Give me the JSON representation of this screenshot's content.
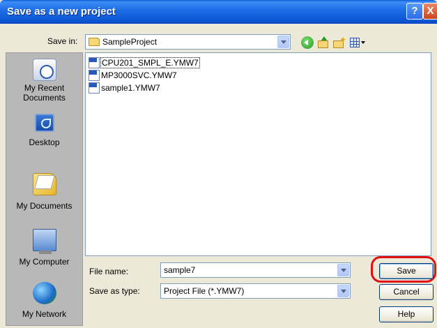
{
  "window": {
    "title": "Save as a new project",
    "help_label": "?",
    "close_label": "X"
  },
  "toolbar": {
    "save_in_label": "Save in:",
    "save_in_value": "SampleProject",
    "icons": [
      "back-icon",
      "up-folder-icon",
      "new-folder-icon",
      "views-menu-icon"
    ]
  },
  "places": [
    {
      "label_line1": "My Recent",
      "label_line2": "Documents",
      "icon": "recent-documents-icon"
    },
    {
      "label_line1": "Desktop",
      "label_line2": "",
      "icon": "desktop-icon"
    },
    {
      "label_line1": "My Documents",
      "label_line2": "",
      "icon": "my-documents-icon"
    },
    {
      "label_line1": "My Computer",
      "label_line2": "",
      "icon": "my-computer-icon"
    },
    {
      "label_line1": "My Network",
      "label_line2": "",
      "icon": "my-network-icon"
    }
  ],
  "files": [
    {
      "name": "CPU201_SMPL_E.YMW7",
      "icon": "mpe-file-icon"
    },
    {
      "name": "MP3000SVC.YMW7",
      "icon": "mpe-file-icon"
    },
    {
      "name": "sample1.YMW7",
      "icon": "mpe-file-icon"
    }
  ],
  "form": {
    "file_name_label": "File name:",
    "file_name_value": "sample7",
    "save_as_type_label": "Save as type:",
    "save_as_type_value": "Project File (*.YMW7)"
  },
  "buttons": {
    "save": "Save",
    "cancel": "Cancel",
    "help": "Help"
  },
  "colors": {
    "titlebar": "#0b54d2",
    "dialog_bg": "#ece9d8",
    "places_bg": "#b8b8b8",
    "highlight": "#e01010"
  }
}
